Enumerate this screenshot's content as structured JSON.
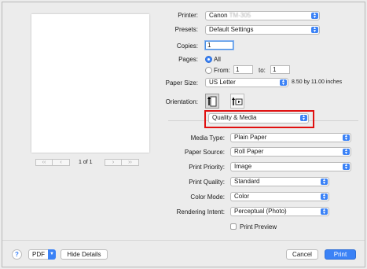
{
  "preview": {
    "page_count": "1 of 1"
  },
  "printer": {
    "label": "Printer:",
    "value": "Canon",
    "model_redacted": "TM-305"
  },
  "presets": {
    "label": "Presets:",
    "value": "Default Settings"
  },
  "copies": {
    "label": "Copies:",
    "value": "1"
  },
  "pages": {
    "label": "Pages:",
    "all_label": "All",
    "from_label": "From:",
    "from_value": "1",
    "to_label": "to:",
    "to_value": "1"
  },
  "paper_size": {
    "label": "Paper Size:",
    "value": "US Letter",
    "dimensions": "8.50 by 11.00 inches"
  },
  "orientation": {
    "label": "Orientation:"
  },
  "panel_select": {
    "value": "Quality & Media"
  },
  "settings": [
    {
      "label": "Media Type:",
      "value": "Plain Paper"
    },
    {
      "label": "Paper Source:",
      "value": "Roll Paper"
    },
    {
      "label": "Print Priority:",
      "value": "Image"
    },
    {
      "label": "Print Quality:",
      "value": "Standard"
    },
    {
      "label": "Color Mode:",
      "value": "Color"
    },
    {
      "label": "Rendering Intent:",
      "value": "Perceptual (Photo)"
    }
  ],
  "print_preview": {
    "label": "Print Preview"
  },
  "footer": {
    "help": "?",
    "pdf": "PDF",
    "hide_details": "Hide Details",
    "cancel": "Cancel",
    "print": "Print"
  },
  "colors": {
    "accent": "#3b82f6",
    "highlight": "#e01010"
  }
}
